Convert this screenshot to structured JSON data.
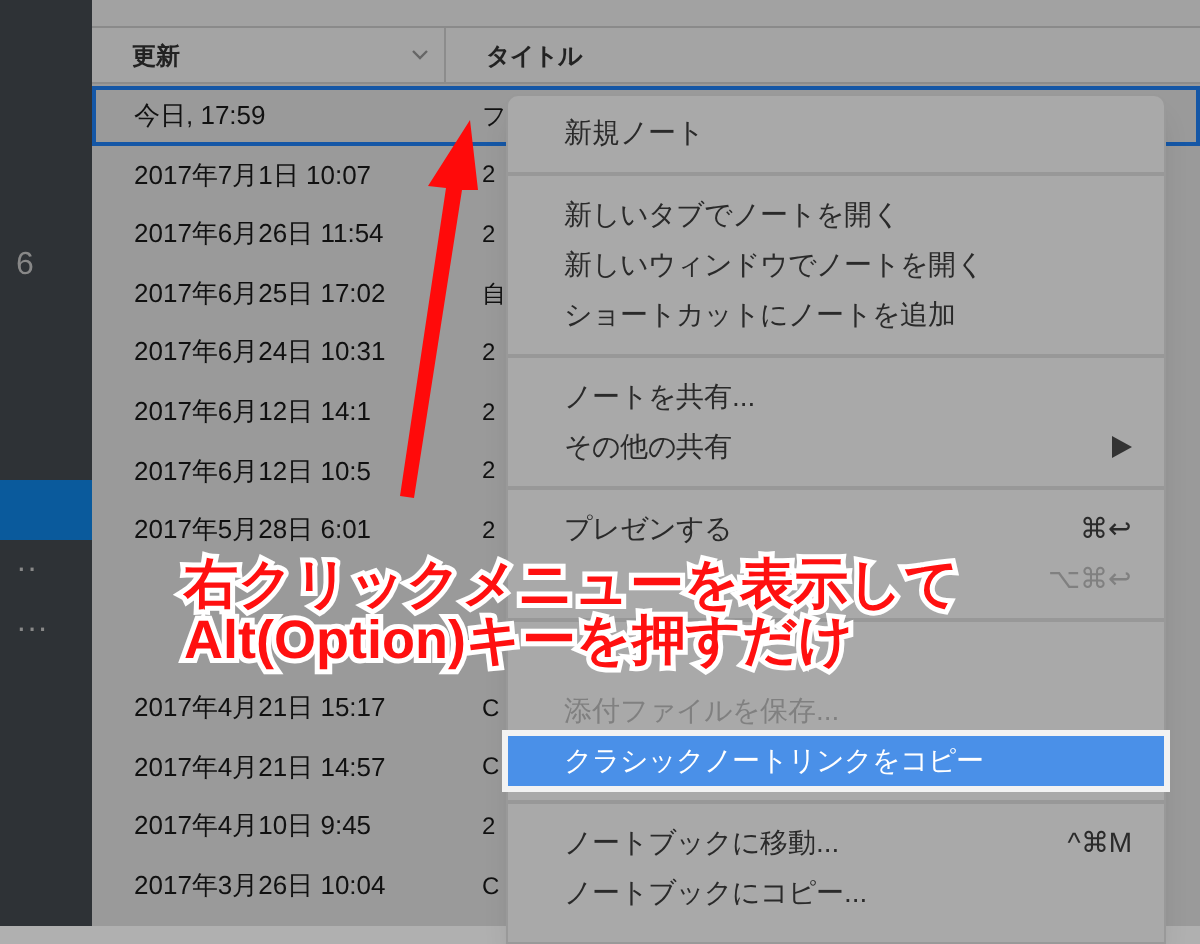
{
  "sidebar": {
    "items": [
      {
        "label": "6",
        "selected": false
      },
      {
        "selected": true
      },
      {
        "label": "··",
        "selected": false
      },
      {
        "label": "···",
        "selected": false
      }
    ]
  },
  "table": {
    "columns": [
      {
        "label": "更新",
        "sorted": true
      },
      {
        "label": "タイトル",
        "sorted": false
      }
    ],
    "rows": [
      {
        "kind": "row",
        "updated": "今日, 17:59",
        "title": "フ",
        "selected": true
      },
      {
        "kind": "row",
        "updated": "2017年7月1日 10:07",
        "title": "2",
        "selected": false
      },
      {
        "kind": "row",
        "updated": "2017年6月26日 11:54",
        "title": "2",
        "selected": false
      },
      {
        "kind": "row",
        "updated": "2017年6月25日 17:02",
        "title": "自",
        "selected": false
      },
      {
        "kind": "row",
        "updated": "2017年6月24日 10:31",
        "title": "2",
        "selected": false
      },
      {
        "kind": "row",
        "updated": "2017年6月12日 14:1",
        "title": "2",
        "selected": false
      },
      {
        "kind": "row",
        "updated": "2017年6月12日 10:5",
        "title": "2",
        "selected": false
      },
      {
        "kind": "row",
        "updated": "2017年5月28日 6:01",
        "title": "2",
        "selected": false
      },
      {
        "kind": "covered"
      },
      {
        "kind": "covered"
      },
      {
        "kind": "row",
        "updated": "2017年4月21日 15:17",
        "title": "C",
        "selected": false
      },
      {
        "kind": "row",
        "updated": "2017年4月21日 14:57",
        "title": "C",
        "selected": false
      },
      {
        "kind": "row",
        "updated": "2017年4月10日 9:45",
        "title": "2",
        "selected": false
      },
      {
        "kind": "row",
        "updated": "2017年3月26日 10:04",
        "title": "C",
        "selected": false
      }
    ]
  },
  "context_menu": {
    "items": [
      {
        "kind": "item",
        "label": "新規ノート",
        "disabled": false,
        "selected": false
      },
      {
        "kind": "separator"
      },
      {
        "kind": "item",
        "label": "新しいタブでノートを開く",
        "disabled": false,
        "selected": false
      },
      {
        "kind": "item",
        "label": "新しいウィンドウでノートを開く",
        "disabled": false,
        "selected": false
      },
      {
        "kind": "item",
        "label": "ショートカットにノートを追加",
        "disabled": false,
        "selected": false
      },
      {
        "kind": "separator"
      },
      {
        "kind": "item",
        "label": "ノートを共有...",
        "disabled": false,
        "selected": false
      },
      {
        "kind": "item",
        "label": "その他の共有",
        "submenu": true,
        "disabled": false,
        "selected": false
      },
      {
        "kind": "separator"
      },
      {
        "kind": "item",
        "label": "プレゼンする",
        "shortcut": "⌘↩",
        "disabled": false,
        "selected": false
      },
      {
        "kind": "item",
        "shortcut": "⌥⌘↩",
        "disabled": true,
        "selected": false
      },
      {
        "kind": "separator"
      },
      {
        "kind": "covered"
      },
      {
        "kind": "item",
        "label": "添付ファイルを保存...",
        "disabled": true,
        "selected": false
      },
      {
        "kind": "item",
        "label": "クラシックノートリンクをコピー",
        "disabled": false,
        "selected": true
      },
      {
        "kind": "separator"
      },
      {
        "kind": "item",
        "label": "ノートブックに移動...",
        "shortcut": "^⌘M",
        "disabled": false,
        "selected": false
      },
      {
        "kind": "item",
        "label": "ノートブックにコピー...",
        "disabled": false,
        "selected": false
      }
    ]
  },
  "annotation": {
    "lines": [
      "右クリックメニューを表示して",
      "Alt(Option)キーを押すだけ"
    ]
  }
}
